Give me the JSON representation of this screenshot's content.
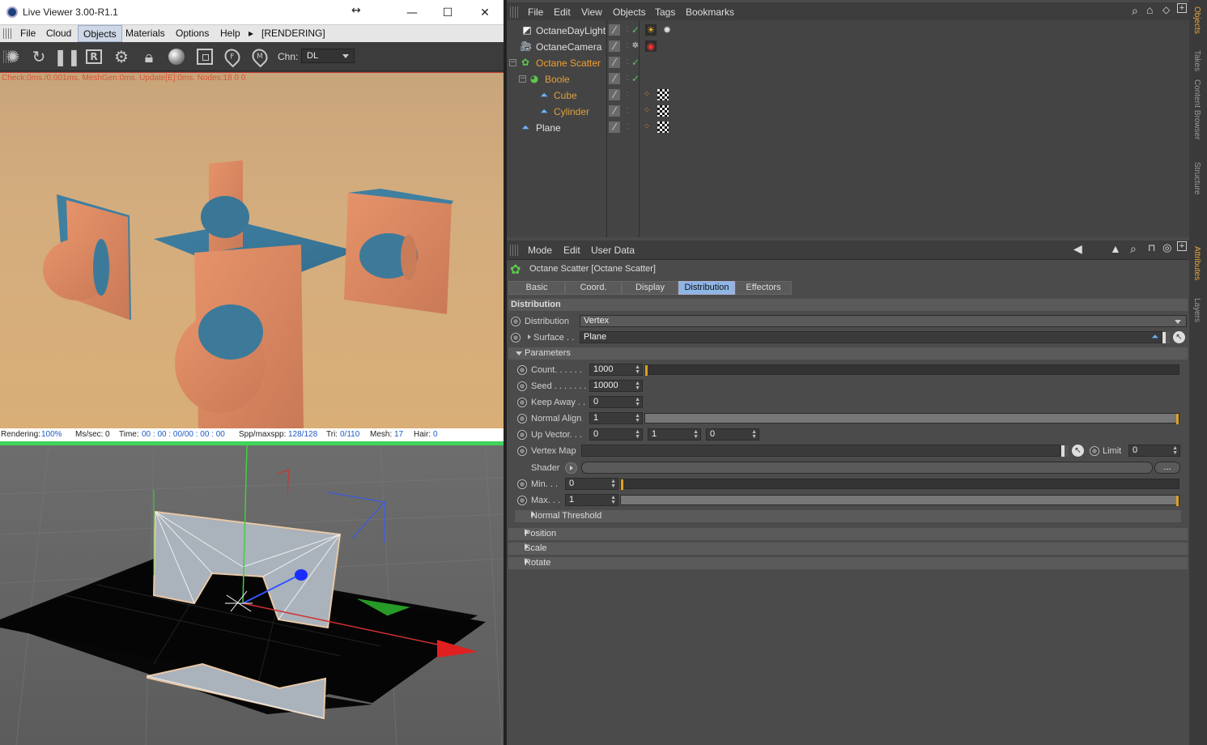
{
  "live_viewer": {
    "title": "Live Viewer 3.00-R1.1",
    "resize_glyph": "↔",
    "menu": [
      "File",
      "Cloud",
      "Objects",
      "Materials",
      "Options",
      "Help"
    ],
    "menu_arrow": "▸",
    "render_state": "[RENDERING]",
    "channel_label": "Chn:",
    "channel_value": "DL",
    "render_info": "Check:0ms./0.001ms. MeshGen:0ms. Update[E]:0ms. Nodes:18  0 0",
    "status": {
      "rendering_label": "Rendering:",
      "rendering_value": "100%",
      "ms_label": "Ms/sec:",
      "ms_value": "0",
      "time_label": "Time:",
      "time_value": "00 : 00 : 00/00 : 00 : 00",
      "spp_label": "Spp/maxspp:",
      "spp_value": "128/128",
      "tri_label": "Tri:",
      "tri_value": "0/110",
      "mesh_label": "Mesh:",
      "mesh_value": "17",
      "hair_label": "Hair:",
      "hair_value": "0"
    }
  },
  "object_manager": {
    "menu": [
      "File",
      "Edit",
      "View",
      "Objects",
      "Tags",
      "Bookmarks"
    ],
    "objects": [
      {
        "name": "OctaneDayLight",
        "color": "#e0e0e0"
      },
      {
        "name": "OctaneCamera",
        "color": "#e0e0e0"
      },
      {
        "name": "Octane Scatter",
        "color": "#f0a030"
      },
      {
        "name": "Boole",
        "color": "#e0a040"
      },
      {
        "name": "Cube",
        "color": "#e0a040"
      },
      {
        "name": "Cylinder",
        "color": "#e0a040"
      },
      {
        "name": "Plane",
        "color": "#e0e0e0"
      }
    ]
  },
  "attributes": {
    "menu": [
      "Mode",
      "Edit",
      "User Data"
    ],
    "object_title": "Octane Scatter [Octane Scatter]",
    "tabs": [
      "Basic",
      "Coord.",
      "Display",
      "Distribution",
      "Effectors"
    ],
    "active_tab": "Distribution",
    "section_title": "Distribution",
    "distribution_label": "Distribution",
    "distribution_value": "Vertex",
    "surface_label": "Surface . .",
    "surface_value": "Plane",
    "parameters_label": "Parameters",
    "count_label": "Count. . . . . .",
    "count_value": "1000",
    "seed_label": "Seed . . . . . . .",
    "seed_value": "10000",
    "keepaway_label": "Keep Away . .",
    "keepaway_value": "0",
    "normalalign_label": "Normal Align",
    "normalalign_value": "1",
    "upvector_label": "Up Vector. . .",
    "upvector_x": "0",
    "upvector_y": "1",
    "upvector_z": "0",
    "vertexmap_label": "Vertex Map",
    "limit_label": "Limit",
    "limit_value": "0",
    "shader_label": "Shader",
    "dots_label": "...",
    "min_label": "Min. . .",
    "min_value": "0",
    "max_label": "Max. . .",
    "max_value": "1",
    "normal_threshold_label": "Normal Threshold",
    "collapsed_sections": [
      "Position",
      "Scale",
      "Rotate"
    ]
  },
  "side_tabs": {
    "top": [
      "Objects",
      "Takes",
      "Content Browser",
      "Structure"
    ],
    "bottom": [
      "Attributes",
      "Layers"
    ]
  }
}
